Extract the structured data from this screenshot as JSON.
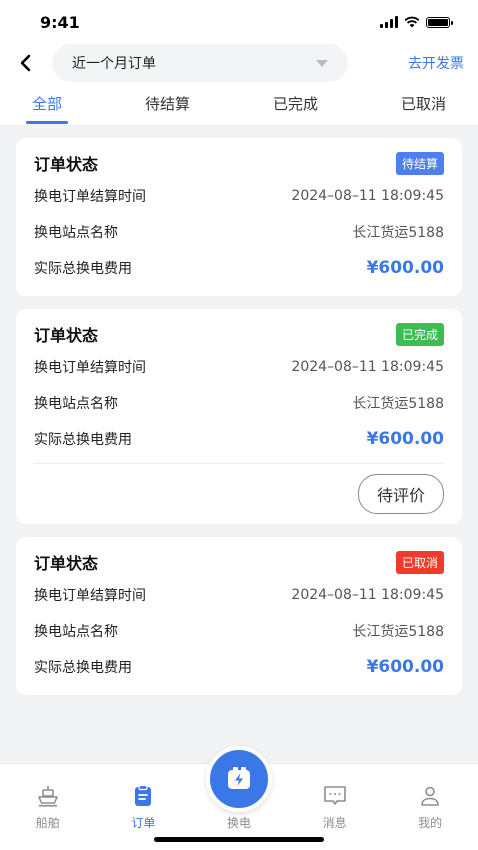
{
  "status_bar": {
    "time": "9:41"
  },
  "header": {
    "period": "近一个月订单",
    "invoice": "去开发票"
  },
  "tabs": [
    {
      "label": "全部",
      "active": true
    },
    {
      "label": "待结算",
      "active": false
    },
    {
      "label": "已完成",
      "active": false
    },
    {
      "label": "已取消",
      "active": false
    }
  ],
  "labels": {
    "status": "订单状态",
    "settle_time": "换电订单结算时间",
    "station": "换电站点名称",
    "fee": "实际总换电费用"
  },
  "orders": [
    {
      "badge": "待结算",
      "time": "2024–08–11 18:09:45",
      "station": "长江货运5188",
      "fee": "¥600.00",
      "badge_color": "#4f7ef0"
    },
    {
      "badge": "已完成",
      "time": "2024–08–11 18:09:45",
      "station": "长江货运5188",
      "fee": "¥600.00",
      "badge_color": "#3dbb55",
      "action": "待评价"
    },
    {
      "badge": "已取消",
      "time": "2024–08–11 18:09:45",
      "station": "长江货运5188",
      "fee": "¥600.00",
      "badge_color": "#ef3b2d"
    }
  ],
  "tabbar": [
    {
      "label": "船舶",
      "icon": "ship-icon"
    },
    {
      "label": "订单",
      "icon": "order-icon",
      "active": true
    },
    {
      "label": "换电",
      "icon": "battery-swap-icon"
    },
    {
      "label": "消息",
      "icon": "message-icon"
    },
    {
      "label": "我的",
      "icon": "profile-icon"
    }
  ],
  "colors": {
    "accent": "#3b78e7"
  }
}
